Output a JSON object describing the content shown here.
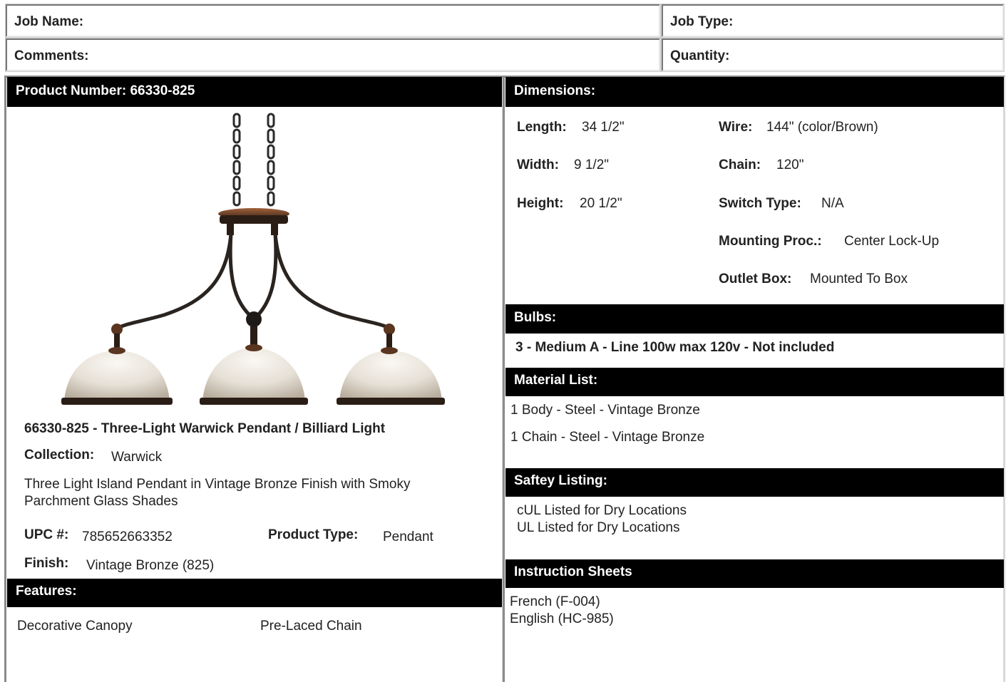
{
  "header": {
    "job_name_label": "Job Name:",
    "job_type_label": "Job Type:",
    "comments_label": "Comments:",
    "quantity_label": "Quantity:"
  },
  "product": {
    "number_header": "Product Number: 66330-825",
    "title": "66330-825 - Three-Light Warwick Pendant / Billiard Light",
    "collection_label": "Collection:",
    "collection_value": "Warwick",
    "description": "Three Light Island Pendant in Vintage Bronze Finish with Smoky Parchment Glass Shades",
    "upc_label": "UPC #:",
    "upc_value": "785652663352",
    "type_label": "Product Type:",
    "type_value": "Pendant",
    "finish_label": "Finish:",
    "finish_value": "Vintage Bronze (825)"
  },
  "features": {
    "header": "Features:",
    "items": [
      "Decorative Canopy",
      "Pre-Laced Chain"
    ]
  },
  "dimensions": {
    "header": "Dimensions:",
    "length_label": "Length:",
    "length_value": "34 1/2\"",
    "width_label": "Width:",
    "width_value": "9 1/2\"",
    "height_label": "Height:",
    "height_value": "20 1/2\"",
    "wire_label": "Wire:",
    "wire_value": "144\" (color/Brown)",
    "chain_label": "Chain:",
    "chain_value": "120\"",
    "switch_label": "Switch Type:",
    "switch_value": "N/A",
    "mounting_label": "Mounting Proc.:",
    "mounting_value": "Center Lock-Up",
    "outlet_label": "Outlet Box:",
    "outlet_value": "Mounted To Box"
  },
  "bulbs": {
    "header": "Bulbs:",
    "text": "3 - Medium A - Line 100w max 120v - Not included"
  },
  "materials": {
    "header": "Material List:",
    "items": [
      "1 Body - Steel - Vintage Bronze",
      "1 Chain - Steel - Vintage Bronze"
    ]
  },
  "safety": {
    "header": "Saftey Listing:",
    "items": [
      "cUL Listed for Dry Locations",
      "UL Listed for Dry Locations"
    ]
  },
  "instructions": {
    "header": "Instruction Sheets",
    "items": [
      "French (F-004)",
      "English (HC-985)"
    ]
  },
  "colors": {
    "bar_bg": "#000000",
    "bronze": "#3a2a1e",
    "copper": "#8a4a2a",
    "glass": "#e8e2d8"
  }
}
